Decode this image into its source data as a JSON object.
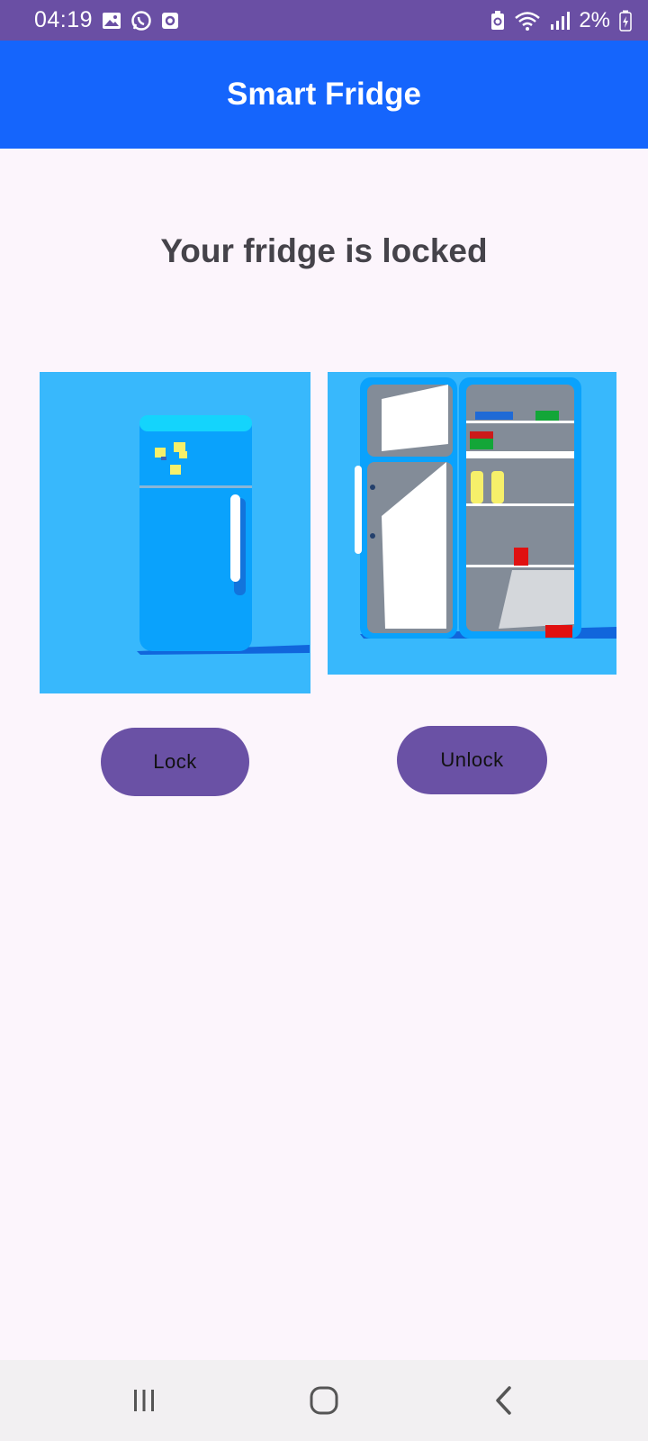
{
  "status_bar": {
    "time": "04:19",
    "battery_pct": "2%",
    "icons_left": [
      "gallery-icon",
      "whatsapp-icon",
      "app-notification-icon"
    ],
    "icons_right": [
      "battery-saver-icon",
      "wifi-icon",
      "signal-icon",
      "battery-icon"
    ]
  },
  "app_bar": {
    "title": "Smart Fridge"
  },
  "main": {
    "status_message": "Your fridge is locked",
    "lock_button": "Lock",
    "unlock_button": "Unlock"
  },
  "nav_bar": {
    "buttons": [
      "recents-icon",
      "home-icon",
      "back-icon"
    ]
  },
  "colors": {
    "status_bar": "#6a4fa4",
    "app_bar": "#1565fc",
    "background": "#fcf5fc",
    "button": "#6a51a5",
    "image_bg": "#38b8fc"
  }
}
